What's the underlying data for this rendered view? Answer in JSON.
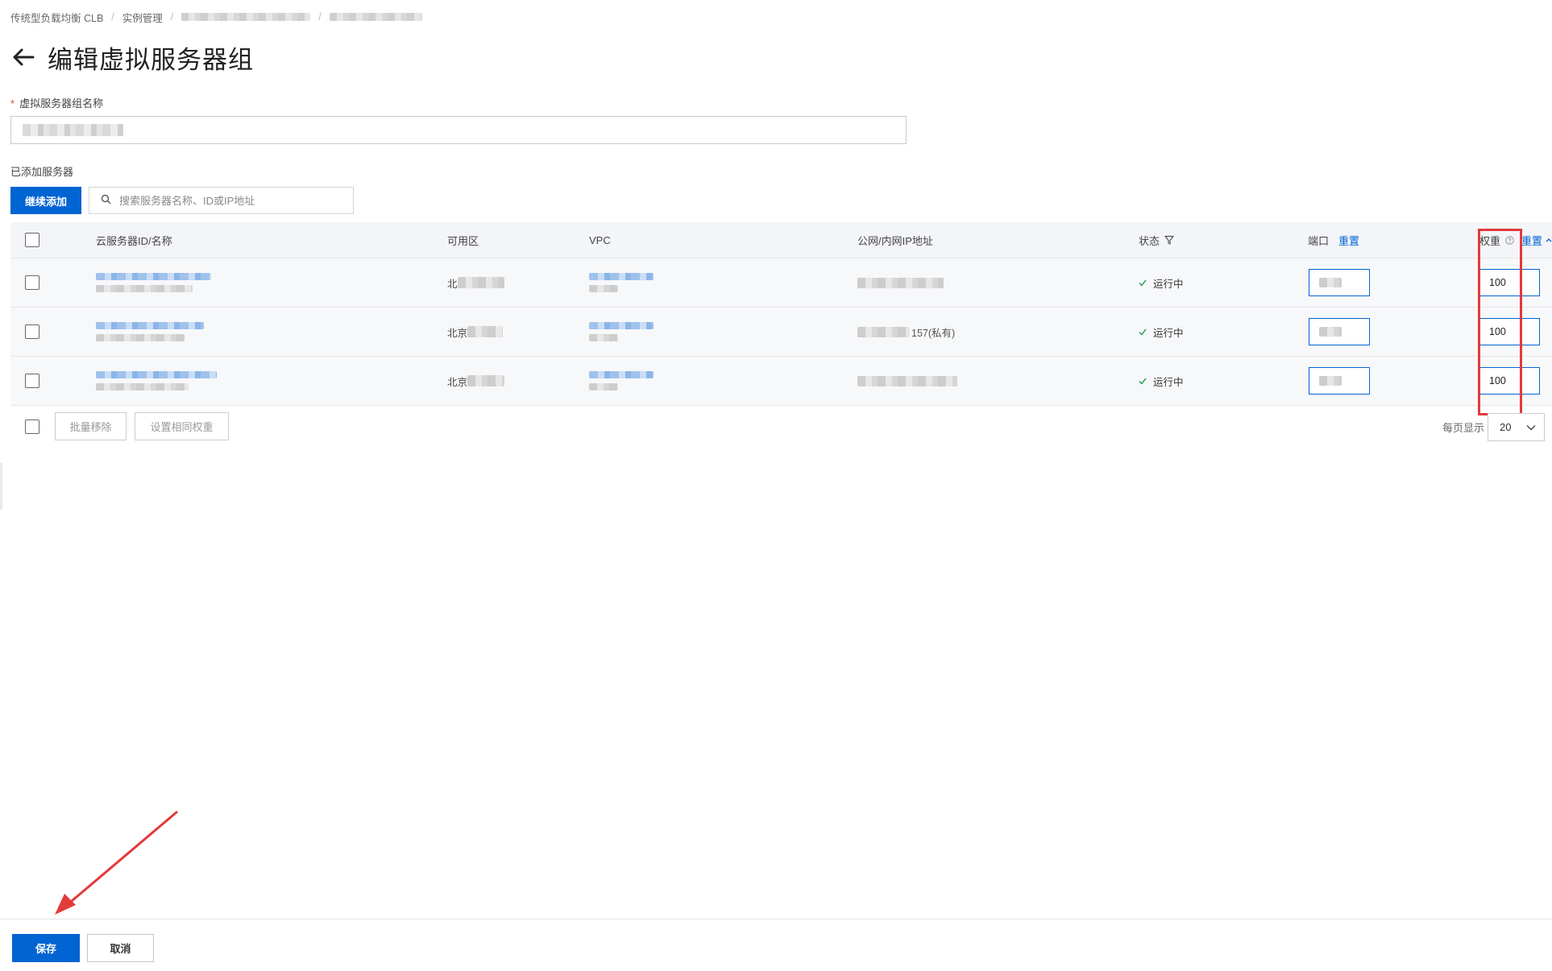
{
  "breadcrumb": {
    "items": [
      "传统型负载均衡 CLB",
      "实例管理"
    ]
  },
  "header": {
    "title": "编辑虚拟服务器组"
  },
  "form": {
    "required_mark": "*",
    "name_label": "虚拟服务器组名称"
  },
  "servers_section": {
    "label": "已添加服务器",
    "add_button": "继续添加",
    "search_placeholder": "搜索服务器名称、ID或IP地址"
  },
  "table": {
    "columns": {
      "server": "云服务器ID/名称",
      "zone": "可用区",
      "vpc": "VPC",
      "ip": "公网/内网IP地址",
      "status": "状态",
      "port": "端口",
      "port_reset": "重置",
      "weight": "权重",
      "weight_reset": "重置"
    },
    "rows": [
      {
        "zone_prefix": "北",
        "ip_suffix": "",
        "status": "运行中",
        "weight": "100"
      },
      {
        "zone_prefix": "北京",
        "ip_suffix": "157(私有)",
        "status": "运行中",
        "weight": "100"
      },
      {
        "zone_prefix": "北京",
        "ip_suffix": "",
        "status": "运行中",
        "weight": "100"
      }
    ],
    "footer": {
      "batch_remove": "批量移除",
      "set_same_weight": "设置相同权重",
      "page_size_label": "每页显示",
      "page_size": "20"
    }
  },
  "actions": {
    "save": "保存",
    "cancel": "取消"
  },
  "colors": {
    "primary": "#0064d2",
    "highlight": "#e33a3a",
    "success": "#2aa65a"
  },
  "icons": [
    "arrow-left-icon",
    "search-icon",
    "filter-icon",
    "help-icon",
    "check-icon",
    "chevron-down-icon"
  ]
}
